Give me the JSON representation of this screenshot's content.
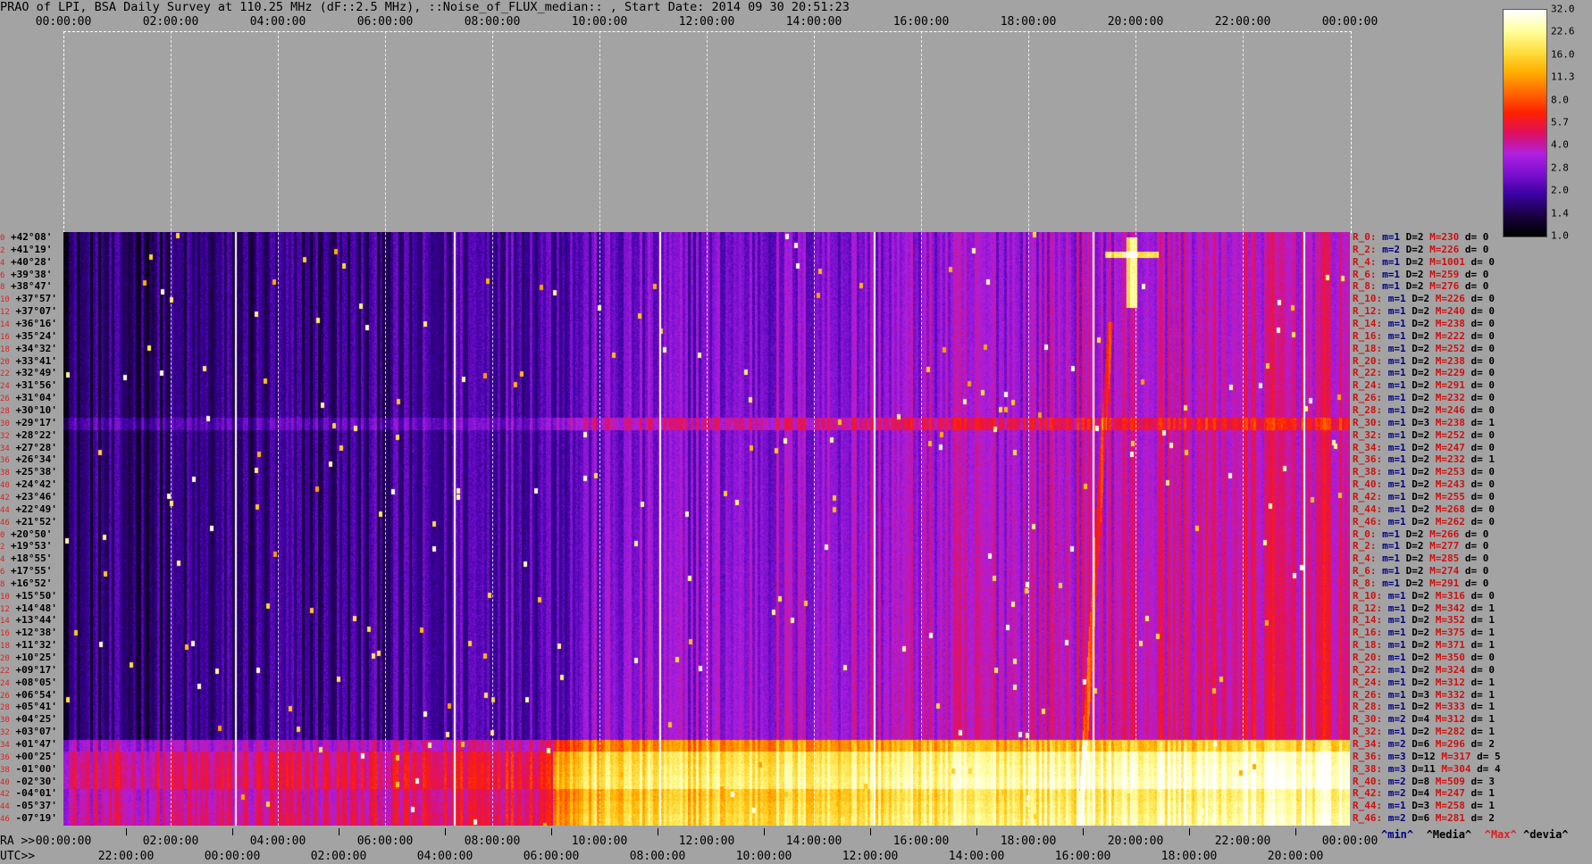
{
  "title": "PRAO of LPI, BSA Daily Survey at 110.25 MHz (dF::2.5 MHz), ::Noise_of_FLUX_median:: , Start Date: 2014 09 30 20:51:23",
  "top_ticks": [
    "00:00:00",
    "02:00:00",
    "04:00:00",
    "06:00:00",
    "08:00:00",
    "10:00:00",
    "12:00:00",
    "14:00:00",
    "16:00:00",
    "18:00:00",
    "20:00:00",
    "22:00:00",
    "00:00:00"
  ],
  "ra_label": "RA >>",
  "utc_label": "UTC>>",
  "ra_ticks": [
    "00:00:00",
    "02:00:00",
    "04:00:00",
    "06:00:00",
    "08:00:00",
    "10:00:00",
    "12:00:00",
    "14:00:00",
    "16:00:00",
    "18:00:00",
    "20:00:00",
    "22:00:00",
    "00:00:00"
  ],
  "utc_ticks": [
    "22:00:00",
    "00:00:00",
    "02:00:00",
    "04:00:00",
    "06:00:00",
    "08:00:00",
    "10:00:00",
    "12:00:00",
    "14:00:00",
    "16:00:00",
    "18:00:00",
    "20:00:00"
  ],
  "colorbar_labels": [
    "32.0",
    "22.6",
    "16.0",
    "11.3",
    "8.0",
    "5.7",
    "4.0",
    "2.8",
    "2.0",
    "1.4",
    "1.0"
  ],
  "colorbar_colors": [
    "#000000",
    "#1a0040",
    "#3a00a0",
    "#7a10d0",
    "#b020e0",
    "#e01060",
    "#ff2000",
    "#ff6a00",
    "#ffb000",
    "#ffe040",
    "#ffffa0",
    "#ffffff"
  ],
  "declinations": [
    "+42°08'",
    "+41°19'",
    "+40°28'",
    "+39°38'",
    "+38°47'",
    "+37°57'",
    "+37°07'",
    "+36°16'",
    "+35°24'",
    "+34°32'",
    "+33°41'",
    "+32°49'",
    "+31°56'",
    "+31°04'",
    "+30°10'",
    "+29°17'",
    "+28°22'",
    "+27°28'",
    "+26°34'",
    "+25°38'",
    "+24°42'",
    "+23°46'",
    "+22°49'",
    "+21°52'",
    "+20°50'",
    "+19°53'",
    "+18°55'",
    "+17°55'",
    "+16°52'",
    "+15°50'",
    "+14°48'",
    "+13°44'",
    "+12°38'",
    "+11°32'",
    "+10°25'",
    "+09°17'",
    "+08°05'",
    "+06°54'",
    "+05°41'",
    "+04°25'",
    "+03°07'",
    "+01°47'",
    "+00°25'",
    "-01°00'",
    "-02°30'",
    "-04°01'",
    "-05°37'",
    "-07°19'"
  ],
  "row_indices": [
    "0",
    "2",
    "4",
    "6",
    "8",
    "10",
    "12",
    "14",
    "16",
    "18",
    "20",
    "22",
    "24",
    "26",
    "28",
    "30",
    "32",
    "34",
    "36",
    "38",
    "40",
    "42",
    "44",
    "46",
    "0",
    "2",
    "4",
    "6",
    "8",
    "10",
    "12",
    "14",
    "16",
    "18",
    "20",
    "22",
    "24",
    "26",
    "28",
    "30",
    "32",
    "34",
    "36",
    "38",
    "40",
    "42",
    "44",
    "46"
  ],
  "row_stats": [
    {
      "r": "R_0:",
      "m": "m=1",
      "d": "D=2",
      "M": "M=230",
      "dev": "d= 0"
    },
    {
      "r": "R_2:",
      "m": "m=2",
      "d": "D=2",
      "M": "M=226",
      "dev": "d= 0"
    },
    {
      "r": "R_4:",
      "m": "m=1",
      "d": "D=2",
      "M": "M=1001",
      "dev": "d= 0"
    },
    {
      "r": "R_6:",
      "m": "m=1",
      "d": "D=2",
      "M": "M=259",
      "dev": "d= 0"
    },
    {
      "r": "R_8:",
      "m": "m=1",
      "d": "D=2",
      "M": "M=276",
      "dev": "d= 0"
    },
    {
      "r": "R_10:",
      "m": "m=1",
      "d": "D=2",
      "M": "M=226",
      "dev": "d= 0"
    },
    {
      "r": "R_12:",
      "m": "m=1",
      "d": "D=2",
      "M": "M=240",
      "dev": "d= 0"
    },
    {
      "r": "R_14:",
      "m": "m=1",
      "d": "D=2",
      "M": "M=238",
      "dev": "d= 0"
    },
    {
      "r": "R_16:",
      "m": "m=1",
      "d": "D=2",
      "M": "M=222",
      "dev": "d= 0"
    },
    {
      "r": "R_18:",
      "m": "m=1",
      "d": "D=2",
      "M": "M=252",
      "dev": "d= 0"
    },
    {
      "r": "R_20:",
      "m": "m=1",
      "d": "D=2",
      "M": "M=238",
      "dev": "d= 0"
    },
    {
      "r": "R_22:",
      "m": "m=1",
      "d": "D=2",
      "M": "M=229",
      "dev": "d= 0"
    },
    {
      "r": "R_24:",
      "m": "m=1",
      "d": "D=2",
      "M": "M=291",
      "dev": "d= 0"
    },
    {
      "r": "R_26:",
      "m": "m=1",
      "d": "D=2",
      "M": "M=232",
      "dev": "d= 0"
    },
    {
      "r": "R_28:",
      "m": "m=1",
      "d": "D=2",
      "M": "M=246",
      "dev": "d= 0"
    },
    {
      "r": "R_30:",
      "m": "m=1",
      "d": "D=3",
      "M": "M=238",
      "dev": "d= 1"
    },
    {
      "r": "R_32:",
      "m": "m=1",
      "d": "D=2",
      "M": "M=252",
      "dev": "d= 0"
    },
    {
      "r": "R_34:",
      "m": "m=1",
      "d": "D=2",
      "M": "M=247",
      "dev": "d= 0"
    },
    {
      "r": "R_36:",
      "m": "m=1",
      "d": "D=2",
      "M": "M=232",
      "dev": "d= 1"
    },
    {
      "r": "R_38:",
      "m": "m=1",
      "d": "D=2",
      "M": "M=253",
      "dev": "d= 0"
    },
    {
      "r": "R_40:",
      "m": "m=1",
      "d": "D=2",
      "M": "M=243",
      "dev": "d= 0"
    },
    {
      "r": "R_42:",
      "m": "m=1",
      "d": "D=2",
      "M": "M=255",
      "dev": "d= 0"
    },
    {
      "r": "R_44:",
      "m": "m=1",
      "d": "D=2",
      "M": "M=268",
      "dev": "d= 0"
    },
    {
      "r": "R_46:",
      "m": "m=1",
      "d": "D=2",
      "M": "M=262",
      "dev": "d= 0"
    },
    {
      "r": "R_0:",
      "m": "m=1",
      "d": "D=2",
      "M": "M=266",
      "dev": "d= 0"
    },
    {
      "r": "R_2:",
      "m": "m=1",
      "d": "D=2",
      "M": "M=277",
      "dev": "d= 0"
    },
    {
      "r": "R_4:",
      "m": "m=1",
      "d": "D=2",
      "M": "M=285",
      "dev": "d= 0"
    },
    {
      "r": "R_6:",
      "m": "m=1",
      "d": "D=2",
      "M": "M=274",
      "dev": "d= 0"
    },
    {
      "r": "R_8:",
      "m": "m=1",
      "d": "D=2",
      "M": "M=291",
      "dev": "d= 0"
    },
    {
      "r": "R_10:",
      "m": "m=1",
      "d": "D=2",
      "M": "M=316",
      "dev": "d= 0"
    },
    {
      "r": "R_12:",
      "m": "m=1",
      "d": "D=2",
      "M": "M=342",
      "dev": "d= 1"
    },
    {
      "r": "R_14:",
      "m": "m=1",
      "d": "D=2",
      "M": "M=352",
      "dev": "d= 1"
    },
    {
      "r": "R_16:",
      "m": "m=1",
      "d": "D=2",
      "M": "M=375",
      "dev": "d= 1"
    },
    {
      "r": "R_18:",
      "m": "m=1",
      "d": "D=2",
      "M": "M=371",
      "dev": "d= 1"
    },
    {
      "r": "R_20:",
      "m": "m=1",
      "d": "D=2",
      "M": "M=350",
      "dev": "d= 0"
    },
    {
      "r": "R_22:",
      "m": "m=1",
      "d": "D=2",
      "M": "M=324",
      "dev": "d= 0"
    },
    {
      "r": "R_24:",
      "m": "m=1",
      "d": "D=2",
      "M": "M=312",
      "dev": "d= 1"
    },
    {
      "r": "R_26:",
      "m": "m=1",
      "d": "D=3",
      "M": "M=332",
      "dev": "d= 1"
    },
    {
      "r": "R_28:",
      "m": "m=1",
      "d": "D=2",
      "M": "M=333",
      "dev": "d= 1"
    },
    {
      "r": "R_30:",
      "m": "m=2",
      "d": "D=4",
      "M": "M=312",
      "dev": "d= 1"
    },
    {
      "r": "R_32:",
      "m": "m=1",
      "d": "D=2",
      "M": "M=282",
      "dev": "d= 1"
    },
    {
      "r": "R_34:",
      "m": "m=2",
      "d": "D=6",
      "M": "M=296",
      "dev": "d= 2"
    },
    {
      "r": "R_36:",
      "m": "m=3",
      "d": "D=12",
      "M": "M=317",
      "dev": "d= 5"
    },
    {
      "r": "R_38:",
      "m": "m=3",
      "d": "D=11",
      "M": "M=304",
      "dev": "d= 4"
    },
    {
      "r": "R_40:",
      "m": "m=2",
      "d": "D=8",
      "M": "M=509",
      "dev": "d= 3"
    },
    {
      "r": "R_42:",
      "m": "m=2",
      "d": "D=4",
      "M": "M=247",
      "dev": "d= 1"
    },
    {
      "r": "R_44:",
      "m": "m=1",
      "d": "D=3",
      "M": "M=258",
      "dev": "d= 1"
    },
    {
      "r": "R_46:",
      "m": "m=2",
      "d": "D=6",
      "M": "M=281",
      "dev": "d= 2"
    }
  ],
  "legend": {
    "min": "^min^",
    "median": "^Media^",
    "max": "^Max^",
    "dev": "^devia^"
  }
}
